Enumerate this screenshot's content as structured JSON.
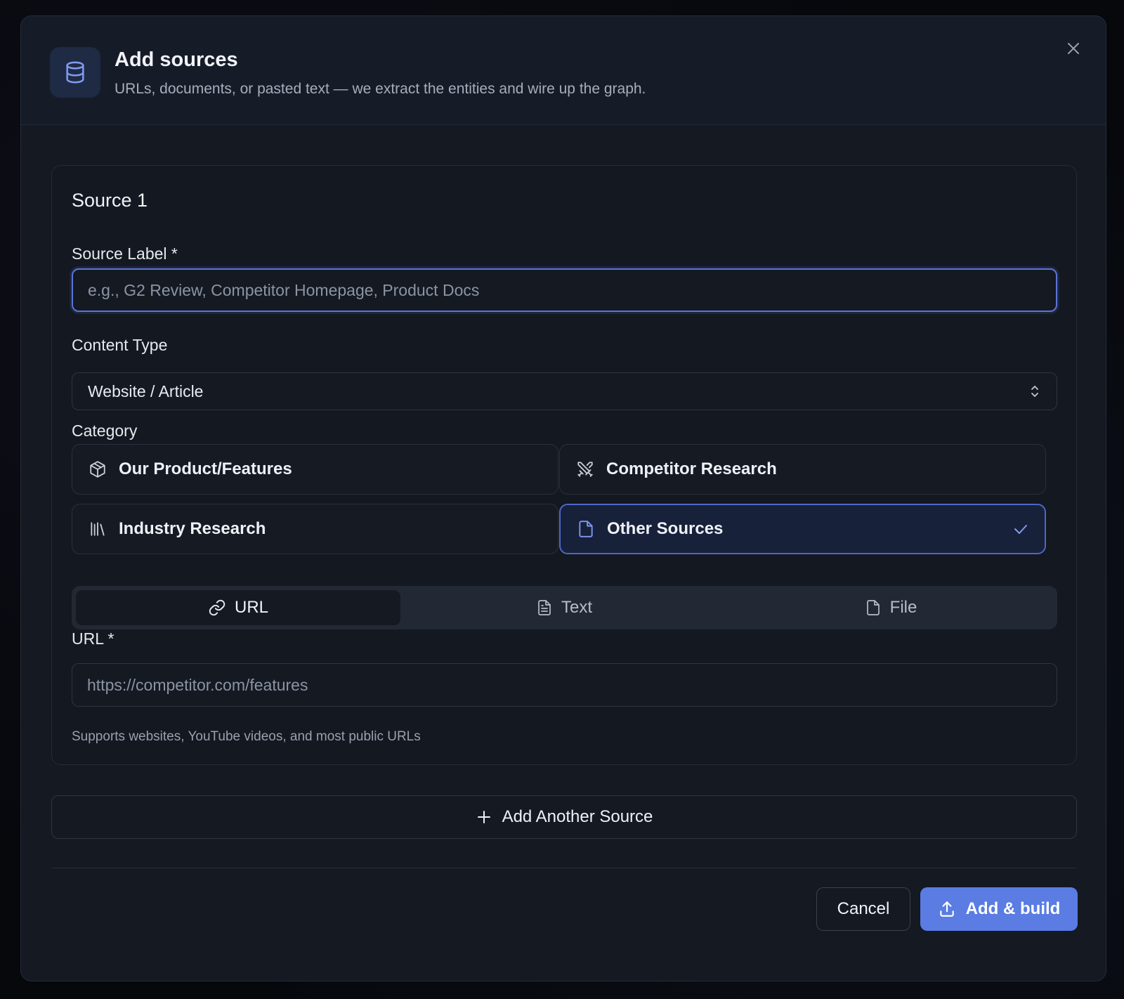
{
  "header": {
    "title": "Add sources",
    "subtitle": "URLs, documents, or pasted text — we extract the entities and wire up the graph.",
    "icon": "database-icon",
    "close_icon": "close-icon"
  },
  "source": {
    "title": "Source 1",
    "label_field": {
      "label": "Source Label *",
      "placeholder": "e.g., G2 Review, Competitor Homepage, Product Docs",
      "value": ""
    },
    "content_type": {
      "label": "Content Type",
      "value": "Website / Article"
    },
    "category": {
      "label": "Category",
      "options": [
        {
          "label": "Our Product/Features",
          "icon": "package-icon",
          "selected": false
        },
        {
          "label": "Competitor Research",
          "icon": "swords-icon",
          "selected": false
        },
        {
          "label": "Industry Research",
          "icon": "library-icon",
          "selected": false
        },
        {
          "label": "Other Sources",
          "icon": "file-icon",
          "selected": true
        }
      ]
    },
    "input_tabs": [
      {
        "label": "URL",
        "icon": "link-icon",
        "active": true
      },
      {
        "label": "Text",
        "icon": "file-text-icon",
        "active": false
      },
      {
        "label": "File",
        "icon": "file-icon",
        "active": false
      }
    ],
    "url_field": {
      "label": "URL *",
      "placeholder": "https://competitor.com/features",
      "value": "",
      "helper": "Supports websites, YouTube videos, and most public URLs"
    }
  },
  "actions": {
    "add_another": "Add Another Source",
    "cancel": "Cancel",
    "submit": "Add & build"
  },
  "colors": {
    "accent": "#5a7ce3",
    "selected_border": "#4e67c6",
    "background": "#141922"
  }
}
